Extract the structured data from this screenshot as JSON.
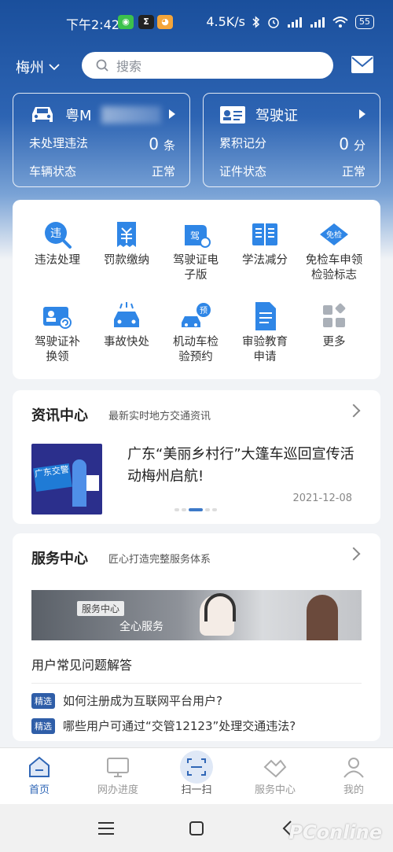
{
  "status_bar": {
    "time": "下午2:42",
    "speed": "4.5K/s",
    "battery": "55"
  },
  "header": {
    "city": "梅州",
    "search_placeholder": "搜索"
  },
  "vehicle_card": {
    "plate_prefix": "粤M",
    "violations_label": "未处理违法",
    "violations_count": "0",
    "violations_unit": "条",
    "status_label": "车辆状态",
    "status_value": "正常"
  },
  "license_card": {
    "title": "驾驶证",
    "points_label": "累积记分",
    "points_value": "0",
    "points_unit": "分",
    "status_label": "证件状态",
    "status_value": "正常"
  },
  "services": [
    {
      "line1": "违法处理",
      "line2": "",
      "icon": "violation-icon"
    },
    {
      "line1": "罚款缴纳",
      "line2": "",
      "icon": "fine-icon"
    },
    {
      "line1": "驾驶证电",
      "line2": "子版",
      "icon": "e-license-icon"
    },
    {
      "line1": "学法减分",
      "line2": "",
      "icon": "study-icon"
    },
    {
      "line1": "免检车申领",
      "line2": "检验标志",
      "icon": "exempt-icon"
    },
    {
      "line1": "驾驶证补",
      "line2": "换领",
      "icon": "license-renew-icon"
    },
    {
      "line1": "事故快处",
      "line2": "",
      "icon": "accident-icon"
    },
    {
      "line1": "机动车检",
      "line2": "验预约",
      "icon": "inspection-icon"
    },
    {
      "line1": "审验教育",
      "line2": "申请",
      "icon": "education-icon"
    },
    {
      "line1": "更多",
      "line2": "",
      "icon": "more-icon"
    }
  ],
  "service_icon_labels": {
    "violation": "违",
    "license": "驾",
    "exempt": "免检",
    "appointment": "预"
  },
  "news": {
    "title": "资讯中心",
    "subtitle": "最新实时地方交通资讯",
    "headline": "广东“美丽乡村行”大篷车巡回宣传活动梅州启航!",
    "date": "2021-12-08",
    "thumb_text": "广东交警"
  },
  "service_center": {
    "title": "服务中心",
    "subtitle": "匠心打造完整服务体系",
    "banner_tag": "服务中心",
    "banner_text": "全心服务",
    "faq_title": "用户常见问题解答",
    "faq_tag": "精选",
    "faqs": [
      "如何注册成为互联网平台用户?",
      "哪些用户可通过“交管12123”处理交通违法?"
    ]
  },
  "bottom_nav": {
    "home": "首页",
    "progress": "网办进度",
    "scan": "扫一扫",
    "service": "服务中心",
    "mine": "我的"
  },
  "watermark": "PConline",
  "colors": {
    "brand": "#2f66b6",
    "hero_top": "#1a4f9c",
    "tag": "#2f5ea8"
  }
}
